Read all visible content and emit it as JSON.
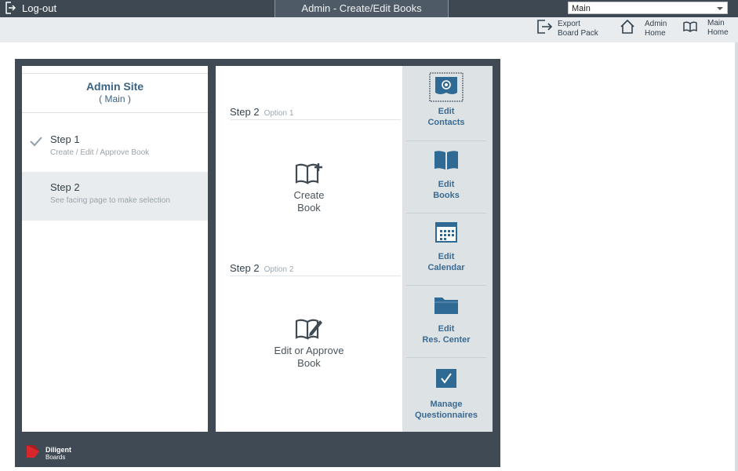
{
  "topbar": {
    "logout_label": "Log-out",
    "window_title": "Admin - Create/Edit Books",
    "site_select": {
      "value": "Main"
    }
  },
  "toolbar": {
    "items": [
      {
        "icon": "export-icon",
        "line1": "Export",
        "line2": "Board Pack"
      },
      {
        "icon": "house-icon",
        "line1": "Admin",
        "line2": "Home"
      },
      {
        "icon": "book-icon",
        "line1": "Main",
        "line2": "Home"
      }
    ]
  },
  "left": {
    "title": "Admin Site",
    "subtitle": "( Main )",
    "steps": [
      {
        "title": "Step 1",
        "desc": "Create / Edit / Approve Book",
        "done": true
      },
      {
        "title": "Step 2",
        "desc": "See facing page to make selection",
        "active": true
      }
    ]
  },
  "middle": {
    "options": [
      {
        "step": "Step 2",
        "option": "Option 1",
        "label_line1": "Create",
        "label_line2": "Book",
        "icon": "book-plus-icon"
      },
      {
        "step": "Step 2",
        "option": "Option 2",
        "label_line1": "Edit or Approve",
        "label_line2": "Book",
        "icon": "book-edit-icon"
      }
    ]
  },
  "right": {
    "buttons": [
      {
        "line1": "Edit",
        "line2": "Contacts",
        "icon": "at-contacts-icon"
      },
      {
        "line1": "Edit",
        "line2": "Books",
        "icon": "open-book-icon"
      },
      {
        "line1": "Edit",
        "line2": "Calendar",
        "icon": "calendar-icon"
      },
      {
        "line1": "Edit",
        "line2": "Res. Center",
        "icon": "folder-icon"
      },
      {
        "line1": "Manage",
        "line2": "Questionnaires",
        "icon": "checkbox-icon"
      }
    ]
  },
  "footer": {
    "brand_line1": "Diligent",
    "brand_line2": "Boards"
  },
  "colors": {
    "topbar": "#3d4852",
    "accent_text": "#3c6384",
    "icon_blue": "#2f6a94",
    "brand_red": "#d7262c"
  }
}
